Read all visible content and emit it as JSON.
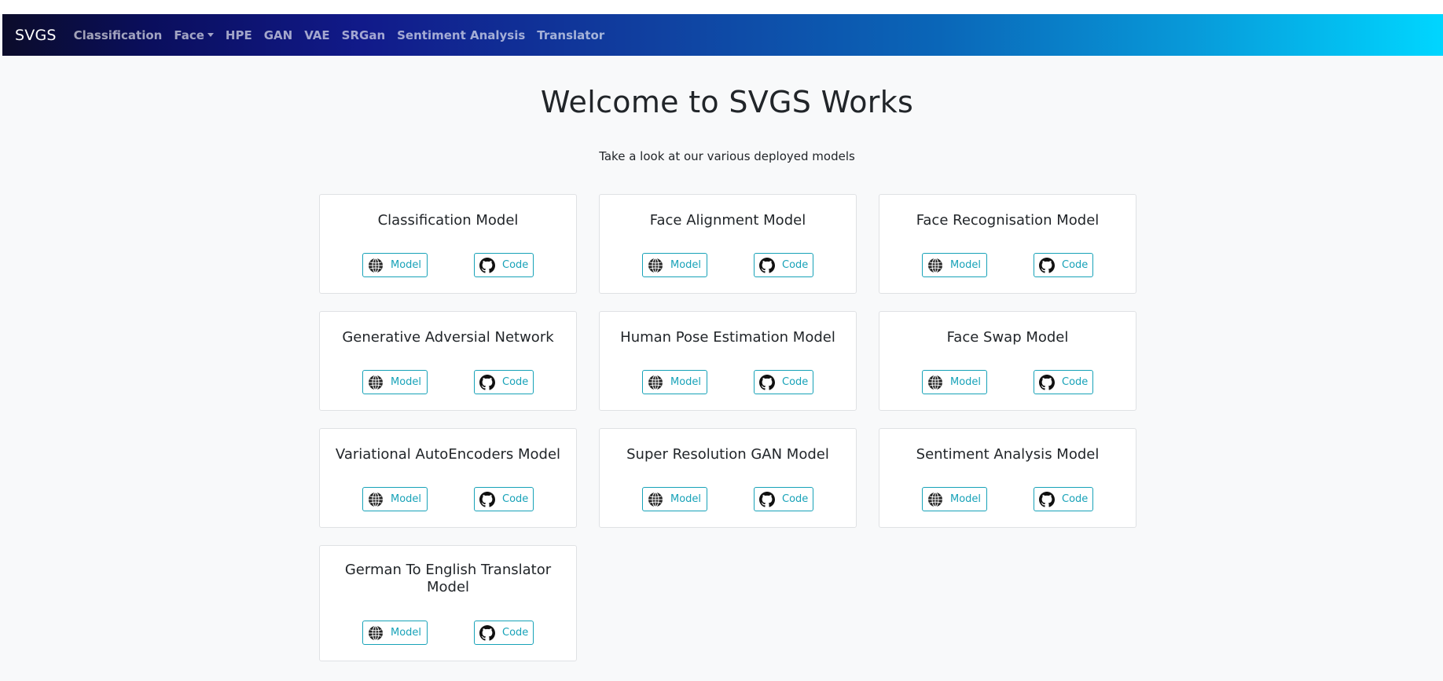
{
  "navbar": {
    "brand": "SVGS",
    "links": [
      "Classification",
      "Face",
      "HPE",
      "GAN",
      "VAE",
      "SRGan",
      "Sentiment Analysis",
      "Translator"
    ]
  },
  "hero": {
    "title": "Welcome to SVGS Works",
    "subtitle": "Take a look at our various deployed models"
  },
  "buttons": {
    "model_label": "Model",
    "code_label": "Code"
  },
  "cards": [
    {
      "title": "Classification Model"
    },
    {
      "title": "Face Alignment Model"
    },
    {
      "title": "Face Recognisation Model"
    },
    {
      "title": "Generative Adversial Network"
    },
    {
      "title": "Human Pose Estimation Model"
    },
    {
      "title": "Face Swap Model"
    },
    {
      "title": "Variational AutoEncoders Model"
    },
    {
      "title": "Super Resolution GAN Model"
    },
    {
      "title": "Sentiment Analysis Model"
    },
    {
      "title": "German To English Translator Model"
    }
  ],
  "colors": {
    "accent": "#17a2b8",
    "page_background": "#f8f9fa",
    "nav_gradient_start": "#0b0c2a",
    "nav_gradient_end": "#00d6ff"
  },
  "icons": {
    "model": "globe-icon",
    "code": "github-icon"
  }
}
